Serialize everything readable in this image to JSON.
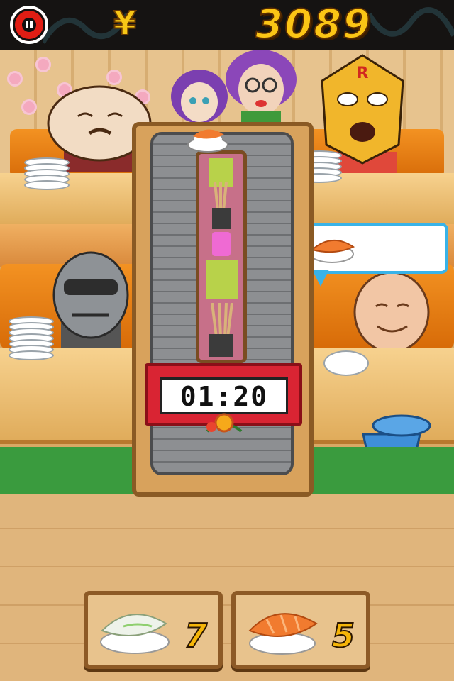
{
  "hud": {
    "currency_symbol": "¥",
    "money": "3089",
    "pause_icon": "pause-icon"
  },
  "timer": {
    "display": "01:20"
  },
  "order_bubble": {
    "item_icon": "salmon-nigiri-icon"
  },
  "customers": [
    {
      "name": "bald-man-customer"
    },
    {
      "name": "purple-hair-girl-customer"
    },
    {
      "name": "purple-hair-woman-customer"
    },
    {
      "name": "masked-wrestler-customer"
    },
    {
      "name": "ninja-customer"
    },
    {
      "name": "old-man-customer"
    }
  ],
  "sushi_selector": [
    {
      "item_icon": "squid-nigiri-icon",
      "count": "7"
    },
    {
      "item_icon": "salmon-nigiri-icon",
      "count": "5"
    }
  ],
  "colors": {
    "money": "#fbc515",
    "timer_frame": "#d92433",
    "bubble_border": "#39b3e8",
    "pause_button": "#e01d14"
  }
}
